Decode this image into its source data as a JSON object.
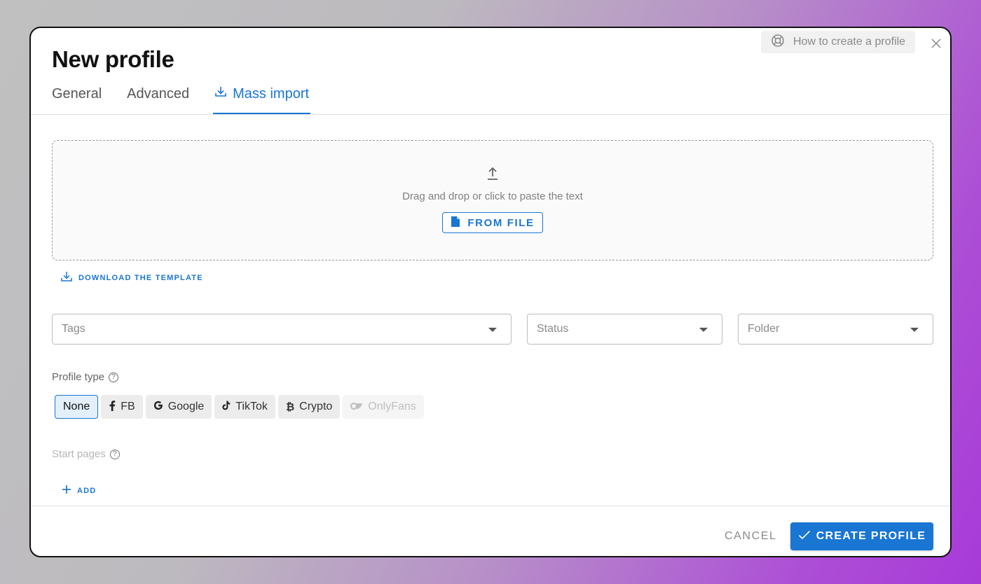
{
  "dialog": {
    "title": "New profile",
    "help_label": "How to create a profile",
    "help_icon": "lifebuoy-icon",
    "close_icon": "close-icon"
  },
  "tabs": [
    {
      "label": "General",
      "active": false
    },
    {
      "label": "Advanced",
      "active": false
    },
    {
      "label": "Mass import",
      "active": true,
      "icon": "download-icon"
    }
  ],
  "dropzone": {
    "icon": "upload-icon",
    "text": "Drag and drop or click to paste the text",
    "button_label": "FROM FILE",
    "button_icon": "file-icon"
  },
  "download_template_label": "DOWNLOAD THE TEMPLATE",
  "fields": {
    "tags_placeholder": "Tags",
    "status_placeholder": "Status",
    "folder_placeholder": "Folder"
  },
  "profile_type": {
    "label": "Profile type",
    "options": [
      {
        "label": "None",
        "icon": "",
        "selected": true,
        "disabled": false
      },
      {
        "label": "FB",
        "icon": "facebook-icon",
        "selected": false,
        "disabled": false
      },
      {
        "label": "Google",
        "icon": "google-icon",
        "selected": false,
        "disabled": false
      },
      {
        "label": "TikTok",
        "icon": "tiktok-icon",
        "selected": false,
        "disabled": false
      },
      {
        "label": "Crypto",
        "icon": "bitcoin-icon",
        "selected": false,
        "disabled": false
      },
      {
        "label": "OnlyFans",
        "icon": "onlyfans-icon",
        "selected": false,
        "disabled": true
      }
    ]
  },
  "start_pages": {
    "label": "Start pages",
    "add_label": "ADD"
  },
  "footer": {
    "cancel_label": "CANCEL",
    "create_label": "CREATE PROFILE"
  },
  "colors": {
    "accent": "#1976d2",
    "selected_chip_bg": "#e3f0fb"
  }
}
